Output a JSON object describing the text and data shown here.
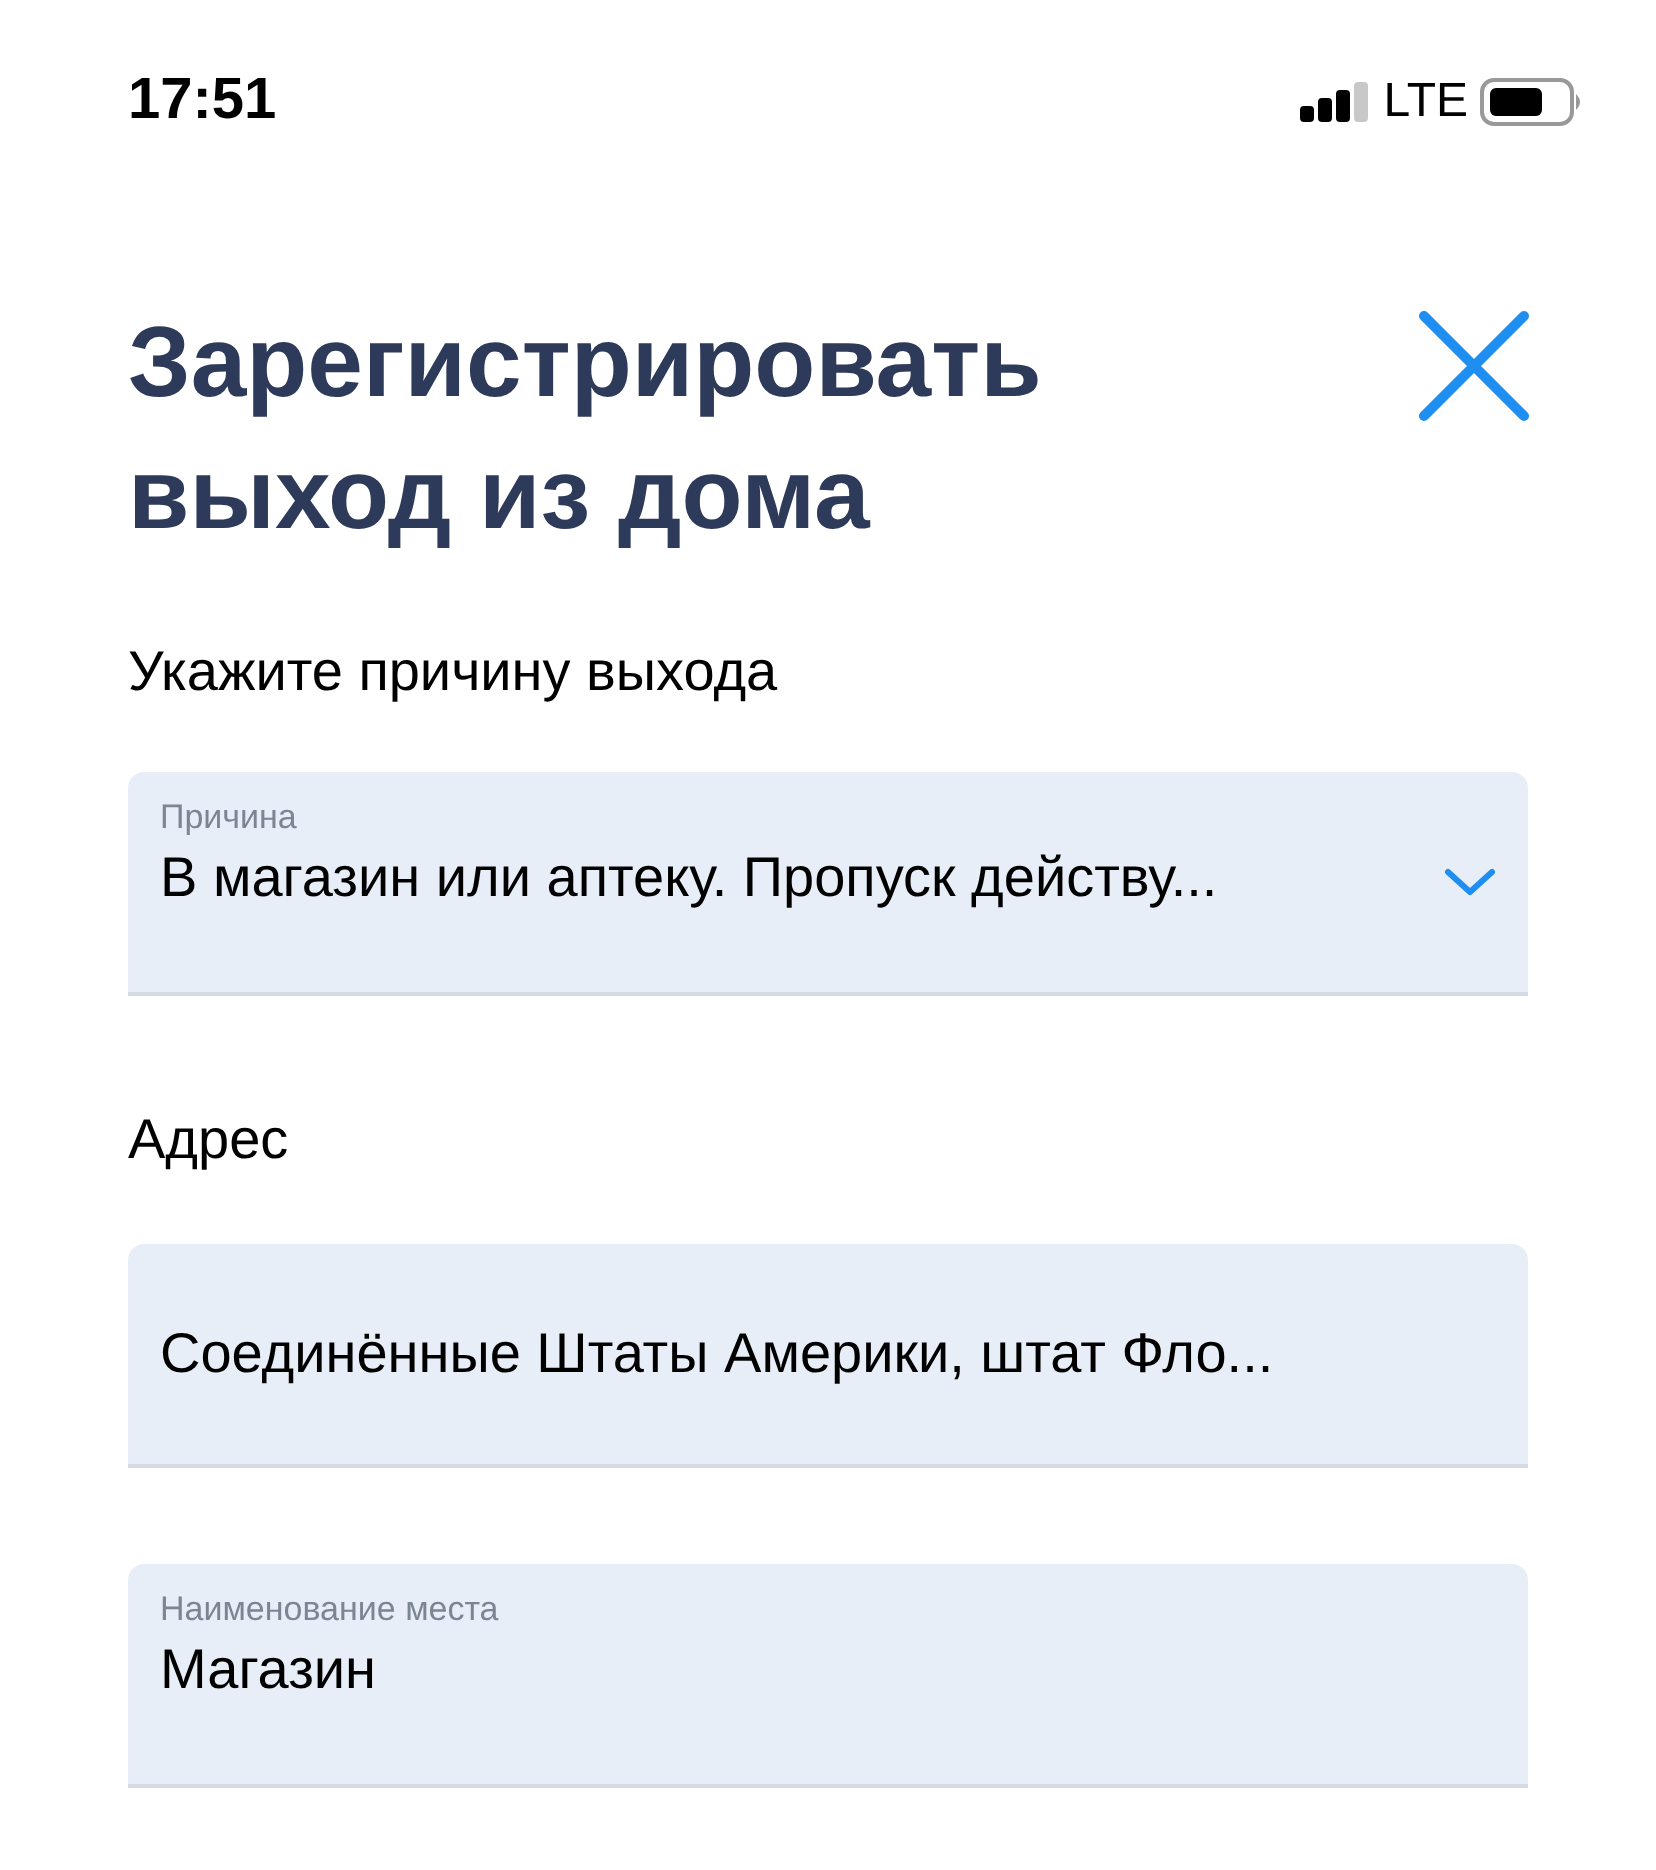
{
  "status_bar": {
    "time": "17:51",
    "network": "LTE"
  },
  "title": "Зарегистрировать выход из дома",
  "items": [
    {
      "kind": "heading",
      "text": "Укажите причину выхода"
    },
    {
      "kind": "select",
      "label": "Причина",
      "value": "В магазин или аптеку. Пропуск действу..."
    },
    {
      "kind": "heading",
      "text": "Адрес"
    },
    {
      "kind": "text",
      "value": "Соединённые Штаты Америки, штат Фло..."
    },
    {
      "kind": "text",
      "label": "Наименование места",
      "value": "Магазин"
    }
  ]
}
